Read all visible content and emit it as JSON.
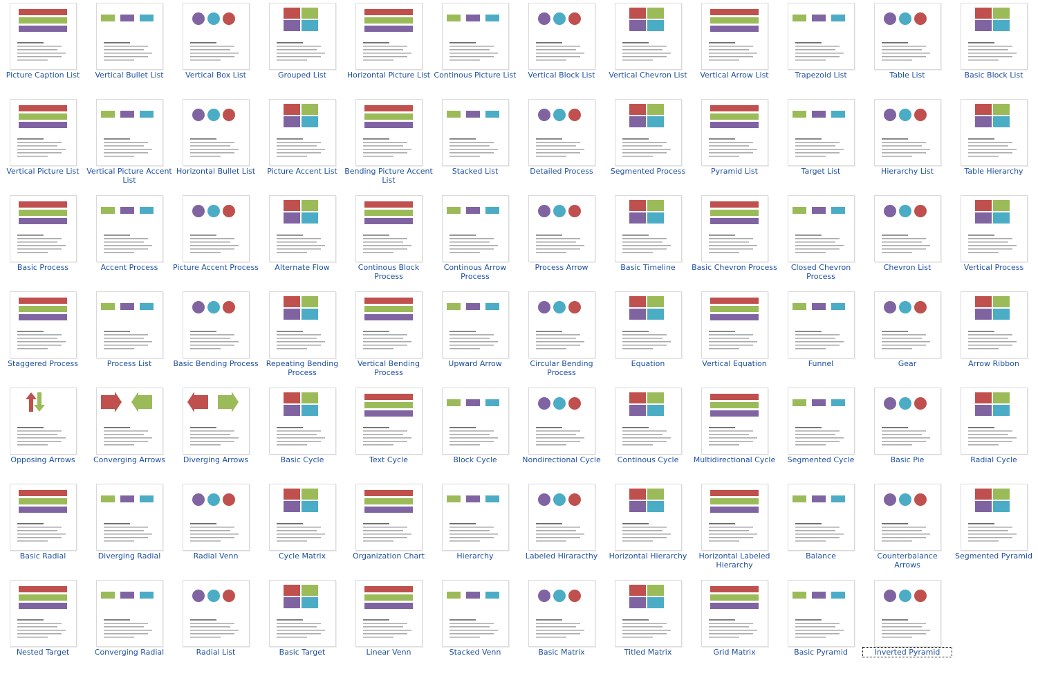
{
  "gallery": {
    "colors": {
      "red": "#c0504d",
      "green": "#9bbb59",
      "purple": "#8064a2",
      "blue": "#4bacc6",
      "link": "#1d4f9f",
      "tan": "#e6b9b8"
    },
    "selected": "Inverted Pyramid",
    "items": [
      {
        "label": "Picture Caption List",
        "icon": "picture-caption-list"
      },
      {
        "label": "Vertical Bullet List",
        "icon": "vertical-bullet-list"
      },
      {
        "label": "Vertical Box List",
        "icon": "vertical-box-list"
      },
      {
        "label": "Grouped List",
        "icon": "grouped-list"
      },
      {
        "label": "Horizontal Picture List",
        "icon": "horizontal-picture-list"
      },
      {
        "label": "Continous Picture List",
        "icon": "continuous-picture-list"
      },
      {
        "label": "Vertical Block List",
        "icon": "vertical-block-list"
      },
      {
        "label": "Vertical Chevron List",
        "icon": "vertical-chevron-list"
      },
      {
        "label": "Vertical Arrow List",
        "icon": "vertical-arrow-list"
      },
      {
        "label": "Trapezoid List",
        "icon": "trapezoid-list"
      },
      {
        "label": "Table List",
        "icon": "table-list"
      },
      {
        "label": "Basic Block List",
        "icon": "basic-block-list"
      },
      {
        "label": "Vertical Picture List",
        "icon": "vertical-picture-list"
      },
      {
        "label": "Vertical Picture Accent List",
        "icon": "vertical-picture-accent-list"
      },
      {
        "label": "Horizontal Bullet List",
        "icon": "horizontal-bullet-list"
      },
      {
        "label": "Picture Accent List",
        "icon": "picture-accent-list"
      },
      {
        "label": "Bending Picture Accent List",
        "icon": "bending-picture-accent-list"
      },
      {
        "label": "Stacked List",
        "icon": "stacked-list"
      },
      {
        "label": "Detailed Process",
        "icon": "detailed-process"
      },
      {
        "label": "Segmented Process",
        "icon": "segmented-process"
      },
      {
        "label": "Pyramid List",
        "icon": "pyramid-list"
      },
      {
        "label": "Target List",
        "icon": "target-list"
      },
      {
        "label": "Hierarchy List",
        "icon": "hierarchy-list"
      },
      {
        "label": "Table Hierarchy",
        "icon": "table-hierarchy"
      },
      {
        "label": "Basic Process",
        "icon": "basic-process"
      },
      {
        "label": "Accent Process",
        "icon": "accent-process"
      },
      {
        "label": "Picture Accent Process",
        "icon": "picture-accent-process"
      },
      {
        "label": "Alternate Flow",
        "icon": "alternate-flow"
      },
      {
        "label": "Continous Block Process",
        "icon": "continuous-block-process"
      },
      {
        "label": "Continous Arrow Process",
        "icon": "continuous-arrow-process"
      },
      {
        "label": "Process Arrow",
        "icon": "process-arrow"
      },
      {
        "label": "Basic Timeline",
        "icon": "basic-timeline"
      },
      {
        "label": "Basic Chevron Process",
        "icon": "basic-chevron-process"
      },
      {
        "label": "Closed Chevron Process",
        "icon": "closed-chevron-process"
      },
      {
        "label": "Chevron List",
        "icon": "chevron-list"
      },
      {
        "label": "Vertical Process",
        "icon": "vertical-process"
      },
      {
        "label": "Staggered Process",
        "icon": "staggered-process"
      },
      {
        "label": "Process List",
        "icon": "process-list"
      },
      {
        "label": "Basic Bending Process",
        "icon": "basic-bending-process"
      },
      {
        "label": "Repeating Bending Process",
        "icon": "repeating-bending-process"
      },
      {
        "label": "Vertical Bending Process",
        "icon": "vertical-bending-process"
      },
      {
        "label": "Upward Arrow",
        "icon": "upward-arrow"
      },
      {
        "label": "Circular Bending Process",
        "icon": "circular-bending-process"
      },
      {
        "label": "Equation",
        "icon": "equation"
      },
      {
        "label": "Vertical Equation",
        "icon": "vertical-equation"
      },
      {
        "label": "Funnel",
        "icon": "funnel"
      },
      {
        "label": "Gear",
        "icon": "gear"
      },
      {
        "label": "Arrow Ribbon",
        "icon": "arrow-ribbon"
      },
      {
        "label": "Opposing Arrows",
        "icon": "opposing-arrows"
      },
      {
        "label": "Converging Arrows",
        "icon": "converging-arrows"
      },
      {
        "label": "Diverging Arrows",
        "icon": "diverging-arrows"
      },
      {
        "label": "Basic Cycle",
        "icon": "basic-cycle"
      },
      {
        "label": "Text Cycle",
        "icon": "text-cycle"
      },
      {
        "label": "Block Cycle",
        "icon": "block-cycle"
      },
      {
        "label": "Nondirectional Cycle",
        "icon": "nondirectional-cycle"
      },
      {
        "label": "Continous Cycle",
        "icon": "continuous-cycle"
      },
      {
        "label": "Multidirectional Cycle",
        "icon": "multidirectional-cycle"
      },
      {
        "label": "Segmented Cycle",
        "icon": "segmented-cycle"
      },
      {
        "label": "Basic Pie",
        "icon": "basic-pie"
      },
      {
        "label": "Radial Cycle",
        "icon": "radial-cycle"
      },
      {
        "label": "Basic Radial",
        "icon": "basic-radial"
      },
      {
        "label": "Diverging Radial",
        "icon": "diverging-radial"
      },
      {
        "label": "Radial Venn",
        "icon": "radial-venn"
      },
      {
        "label": "Cycle Matrix",
        "icon": "cycle-matrix"
      },
      {
        "label": "Organization Chart",
        "icon": "organization-chart"
      },
      {
        "label": "Hierarchy",
        "icon": "hierarchy"
      },
      {
        "label": "Labeled Hiraracthy",
        "icon": "labeled-hierarchy"
      },
      {
        "label": "Horizontal Hierarchy",
        "icon": "horizontal-hierarchy"
      },
      {
        "label": "Horizontal Labeled Hierarchy",
        "icon": "horizontal-labeled-hierarchy"
      },
      {
        "label": "Balance",
        "icon": "balance"
      },
      {
        "label": "Counterbalance Arrows",
        "icon": "counterbalance-arrows"
      },
      {
        "label": "Segmented Pyramid",
        "icon": "segmented-pyramid"
      },
      {
        "label": "Nested Target",
        "icon": "nested-target"
      },
      {
        "label": "Converging Radial",
        "icon": "converging-radial"
      },
      {
        "label": "Radial List",
        "icon": "radial-list"
      },
      {
        "label": "Basic Target",
        "icon": "basic-target"
      },
      {
        "label": "Linear Venn",
        "icon": "linear-venn"
      },
      {
        "label": "Stacked Venn",
        "icon": "stacked-venn"
      },
      {
        "label": "Basic Matrix",
        "icon": "basic-matrix"
      },
      {
        "label": "Titled Matrix",
        "icon": "titled-matrix"
      },
      {
        "label": "Grid Matrix",
        "icon": "grid-matrix"
      },
      {
        "label": "Basic Pyramid",
        "icon": "basic-pyramid"
      },
      {
        "label": "Inverted Pyramid",
        "icon": "inverted-pyramid"
      }
    ]
  }
}
